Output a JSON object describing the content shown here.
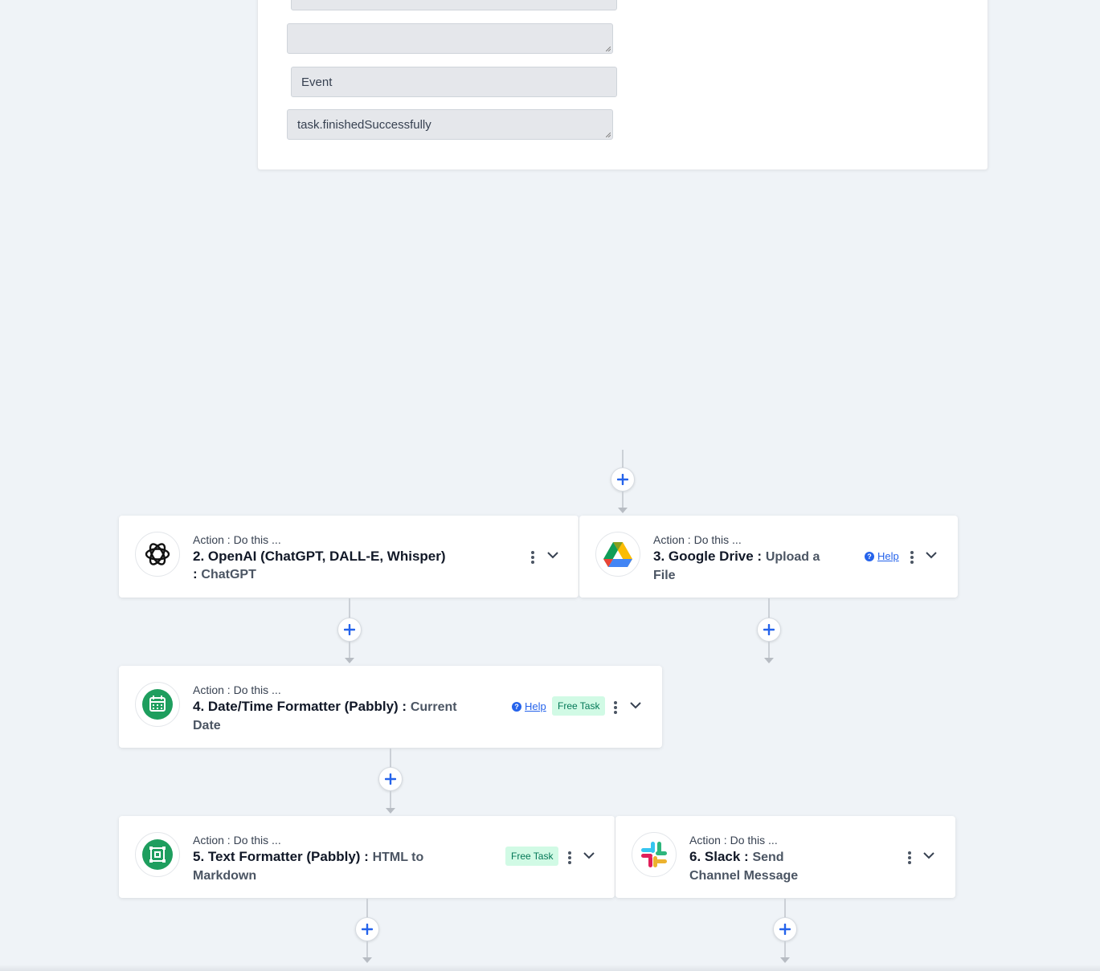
{
  "top_panel": {
    "fields": [
      {
        "value": "",
        "type": "input"
      },
      {
        "value": "",
        "type": "textarea"
      },
      {
        "value": "Event",
        "type": "input"
      },
      {
        "value": "task.finishedSuccessfully",
        "type": "textarea"
      }
    ]
  },
  "cards": [
    {
      "subtitle": "Action : Do this ...",
      "app": "2. OpenAI (ChatGPT, DALL-E, Whisper) :",
      "event": "ChatGPT",
      "icon": "openai-icon",
      "help": "",
      "badge": ""
    },
    {
      "subtitle": "Action : Do this ...",
      "app": "3. Google Drive :",
      "event": "Upload a File",
      "icon": "google-drive-icon",
      "help": "Help",
      "badge": ""
    },
    {
      "subtitle": "Action : Do this ...",
      "app": "4. Date/Time Formatter (Pabbly) :",
      "event": "Current Date",
      "icon": "calendar-icon",
      "help": "Help",
      "badge": "Free Task"
    },
    {
      "subtitle": "Action : Do this ...",
      "app": "5. Text Formatter (Pabbly) :",
      "event": "HTML to Markdown",
      "icon": "text-formatter-icon",
      "help": "",
      "badge": "Free Task"
    },
    {
      "subtitle": "Action : Do this ...",
      "app": "6. Slack :",
      "event": "Send Channel Message",
      "icon": "slack-icon",
      "help": "",
      "badge": ""
    }
  ],
  "colors": {
    "accent": "#2563eb",
    "badge_bg": "#d1fae5",
    "badge_text": "#047857",
    "background": "#eff3f7"
  }
}
